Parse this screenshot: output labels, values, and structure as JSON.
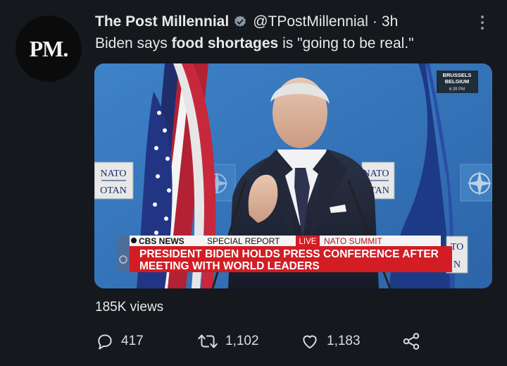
{
  "account": {
    "avatar_text": "PM.",
    "name": "The Post Millennial",
    "handle": "@TPostMillennial",
    "separator": "·",
    "time": "3h"
  },
  "tweet": {
    "text_part1": "Biden says ",
    "text_bold": "food shortages",
    "text_part2": " is \"going to be real.\""
  },
  "media": {
    "location_line1": "BRUSSELS",
    "location_line2": "BELGIUM",
    "location_time": "6:39 PM",
    "nato_sign_line1": "NATO",
    "nato_sign_line2": "OTAN",
    "nato_sign2_line1": "NATO",
    "nato_sign2_line2": "OTAN",
    "nato_sign3_line1": "TO",
    "nato_sign3_line2": "N",
    "network": "CBS NEWS",
    "program": "SPECIAL REPORT",
    "live": "LIVE",
    "event": "NATO SUMMIT",
    "headline_line1": "PRESIDENT BIDEN HOLDS PRESS CONFERENCE AFTER",
    "headline_line2": "MEETING WITH WORLD LEADERS"
  },
  "stats": {
    "views": "185K views",
    "replies": "417",
    "retweets": "1,102",
    "likes": "1,183"
  },
  "icons": {
    "verified": "verified-badge-icon",
    "more": "more-options-icon",
    "reply": "reply-icon",
    "retweet": "retweet-icon",
    "like": "heart-icon",
    "share": "share-icon"
  },
  "colors": {
    "background": "#15181c",
    "text": "#e7e9ea",
    "muted": "#8b98a5",
    "banner_red": "#d21d24",
    "stage_blue": "#2f6cb5"
  }
}
